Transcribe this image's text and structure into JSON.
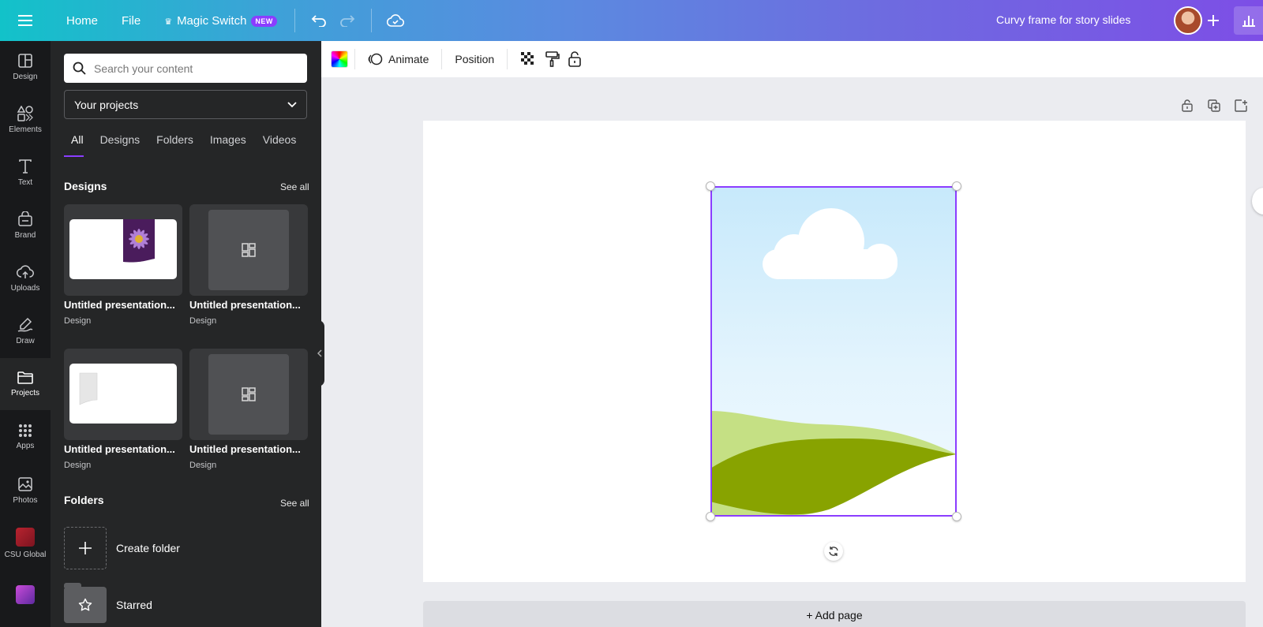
{
  "topbar": {
    "home": "Home",
    "file": "File",
    "magic_switch": "Magic Switch",
    "new_badge": "NEW",
    "design_title": "Curvy frame for story slides"
  },
  "rail": {
    "items": [
      {
        "label": "Design",
        "icon": "design-icon"
      },
      {
        "label": "Elements",
        "icon": "elements-icon"
      },
      {
        "label": "Text",
        "icon": "text-icon"
      },
      {
        "label": "Brand",
        "icon": "brand-icon"
      },
      {
        "label": "Uploads",
        "icon": "uploads-icon"
      },
      {
        "label": "Draw",
        "icon": "draw-icon"
      },
      {
        "label": "Projects",
        "icon": "projects-icon"
      },
      {
        "label": "Apps",
        "icon": "apps-icon"
      },
      {
        "label": "Photos",
        "icon": "photos-icon"
      },
      {
        "label": "CSU Global",
        "icon": "csu-global-app-icon"
      }
    ],
    "active": "Projects"
  },
  "panel": {
    "search_placeholder": "Search your content",
    "select_value": "Your projects",
    "tabs": [
      "All",
      "Designs",
      "Folders",
      "Images",
      "Videos"
    ],
    "active_tab": "All",
    "designs_title": "Designs",
    "designs_see_all": "See all",
    "designs": [
      {
        "title": "Untitled presentation...",
        "type": "Design"
      },
      {
        "title": "Untitled presentation...",
        "type": "Design"
      },
      {
        "title": "Untitled presentation...",
        "type": "Design"
      },
      {
        "title": "Untitled presentation...",
        "type": "Design"
      }
    ],
    "folders_title": "Folders",
    "folders_see_all": "See all",
    "create_folder": "Create folder",
    "starred": "Starred"
  },
  "toolbar": {
    "animate": "Animate",
    "position": "Position"
  },
  "canvas": {
    "add_page": "+ Add page"
  },
  "colors": {
    "accent": "#8b3dff",
    "hill_light": "#c5e084",
    "hill_dark": "#88a300",
    "sky_top": "#c7e9fb"
  }
}
